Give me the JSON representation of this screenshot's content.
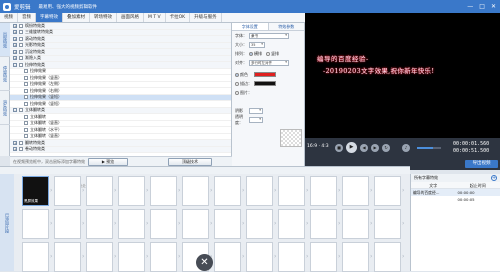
{
  "app": {
    "name": "爱剪辑",
    "slogan": "最易用、强大的视频剪辑软件",
    "window_controls": [
      "—",
      "□",
      "✕"
    ]
  },
  "menu": [
    "视频",
    "音频",
    "字幕特效",
    "叠加素材",
    "转场特效",
    "画面风格",
    "M T V",
    "卡拉OK",
    "升级与服务"
  ],
  "sidenav": [
    "出现特效",
    "停留特效",
    "消失特效"
  ],
  "tree": [
    {
      "type": "cat",
      "label": "缤纷特效类",
      "toggle": "+"
    },
    {
      "type": "cat",
      "label": "三维旋转特效类",
      "toggle": "+"
    },
    {
      "type": "cat",
      "label": "滚动特效类",
      "toggle": "+"
    },
    {
      "type": "cat",
      "label": "光影特效类",
      "toggle": "+"
    },
    {
      "type": "cat",
      "label": "沉淀特效类",
      "toggle": "+"
    },
    {
      "type": "cat",
      "label": "渐隐入类",
      "toggle": "+"
    },
    {
      "type": "cat",
      "label": "拉伸特效类",
      "toggle": "-"
    },
    {
      "type": "sub",
      "label": "拉伸效果"
    },
    {
      "type": "sub",
      "label": "拉伸效果（竖直）"
    },
    {
      "type": "sub",
      "label": "拉伸效果（左侧）"
    },
    {
      "type": "sub",
      "label": "拉伸效果（右侧）"
    },
    {
      "type": "sub",
      "label": "拉伸效果（竖短）",
      "selected": true
    },
    {
      "type": "sub",
      "label": "拉伸效果（竖短）"
    },
    {
      "type": "cat",
      "label": "立体翻转类",
      "toggle": "-"
    },
    {
      "type": "sub",
      "label": "立体翻转"
    },
    {
      "type": "sub",
      "label": "立体翻转（竖直）"
    },
    {
      "type": "sub",
      "label": "立体翻转（水平）"
    },
    {
      "type": "sub",
      "label": "立体翻转（竖直）"
    },
    {
      "type": "cat",
      "label": "翻转特效类",
      "toggle": "+"
    },
    {
      "type": "cat",
      "label": "卷动特效类",
      "toggle": "+"
    }
  ],
  "hint": "在视频预览框中，双击鼠标添加字幕特效",
  "buttons": {
    "play": "▶  预览",
    "advanced": "顶级技术"
  },
  "settings": {
    "tabs": [
      "字体设置",
      "特效参数"
    ],
    "font_label": "字体：",
    "font_value": "隶书",
    "size_label": "大小：",
    "size_value": "35",
    "layout_label": "排列：",
    "layout_h": "横排",
    "layout_v": "竖排",
    "align_label": "对齐：",
    "align_value": "多行时左对齐",
    "color_label": "颜色",
    "outline_label": "描边：",
    "texture_label": "图片：",
    "shadow_label": "阴影",
    "effect_label": "透明度："
  },
  "preview": {
    "line1": "编导的百度经验-",
    "line2": "-20190203文字效果,祝你新年快乐!"
  },
  "player": {
    "ratio": "16:9 · 4:3",
    "time_current": "00:00:01.560",
    "time_total": "00:00:51.500",
    "export_label": "导出视频"
  },
  "timeline": {
    "label": "已添加片段",
    "clip_name": "黑屏效果",
    "add_text": "双击此处添加视频"
  },
  "list_panel": {
    "title": "所有字幕特效",
    "cols": [
      "文字",
      "起止时间"
    ],
    "rows": [
      {
        "text": "编导的百度经...",
        "time": "00:00:00"
      },
      {
        "text": "",
        "time": "00:00:05"
      }
    ]
  },
  "colors": {
    "accent": "#3a78c9",
    "caption_glow": "#e23"
  }
}
